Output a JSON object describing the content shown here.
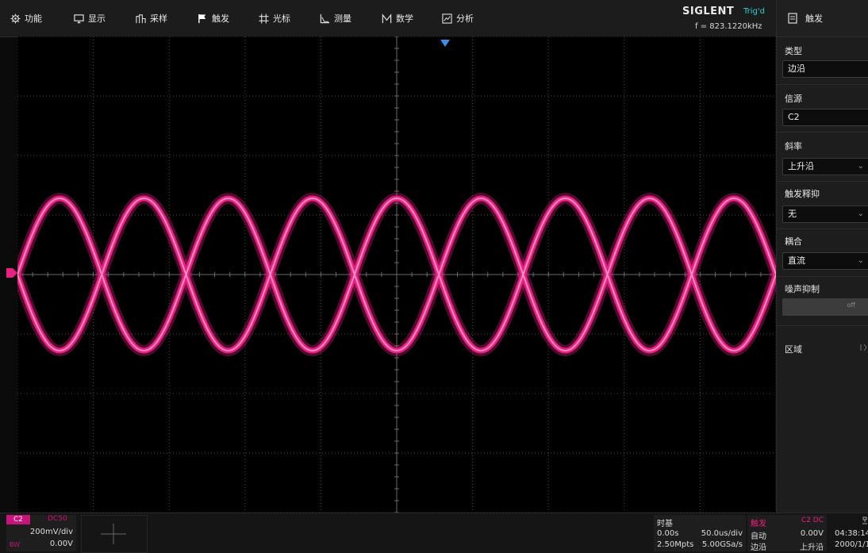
{
  "menu": {
    "items": [
      {
        "label": "功能",
        "icon": "gear-icon"
      },
      {
        "label": "显示",
        "icon": "monitor-icon"
      },
      {
        "label": "采样",
        "icon": "sample-icon"
      },
      {
        "label": "触发",
        "icon": "flag-icon"
      },
      {
        "label": "光标",
        "icon": "cursor-grid-icon"
      },
      {
        "label": "测量",
        "icon": "measure-icon"
      },
      {
        "label": "数学",
        "icon": "math-icon"
      },
      {
        "label": "分析",
        "icon": "analysis-icon"
      }
    ]
  },
  "header": {
    "brand": "SIGLENT",
    "trig_state": "Trig'd",
    "frequency": "f = 823.1220kHz"
  },
  "panel": {
    "title": "触发",
    "type_label": "类型",
    "type_value": "边沿",
    "source_label": "信源",
    "source_value": "C2",
    "slope_label": "斜率",
    "slope_value": "上升沿",
    "holdoff_label": "触发释抑",
    "holdoff_value": "无",
    "coupling_label": "耦合",
    "coupling_value": "直流",
    "noise_label": "噪声抑制",
    "noise_value": "off",
    "zone_label": "区域"
  },
  "channel": {
    "name": "C2",
    "coupling": "DC50",
    "scale": "200mV/div",
    "offset": "0.00V",
    "bw": "BW"
  },
  "timebase": {
    "label": "时基",
    "delay": "0.00s",
    "scale": "50.0us/div",
    "memory": "2.50Mpts",
    "rate": "5.00GSa/s"
  },
  "trigger": {
    "label": "触发",
    "src_cpl": "C2 DC",
    "mode": "自动",
    "level": "0.00V",
    "type": "边沿",
    "slope": "上升沿"
  },
  "clock": {
    "time": "04:38:14",
    "date": "2000/1/1"
  },
  "colors": {
    "channel2": "#e8207f",
    "trig_state": "#2fd0d0",
    "trigger_marker": "#3a8ee6"
  },
  "waveform": {
    "cycles_visible": 4.5
  }
}
